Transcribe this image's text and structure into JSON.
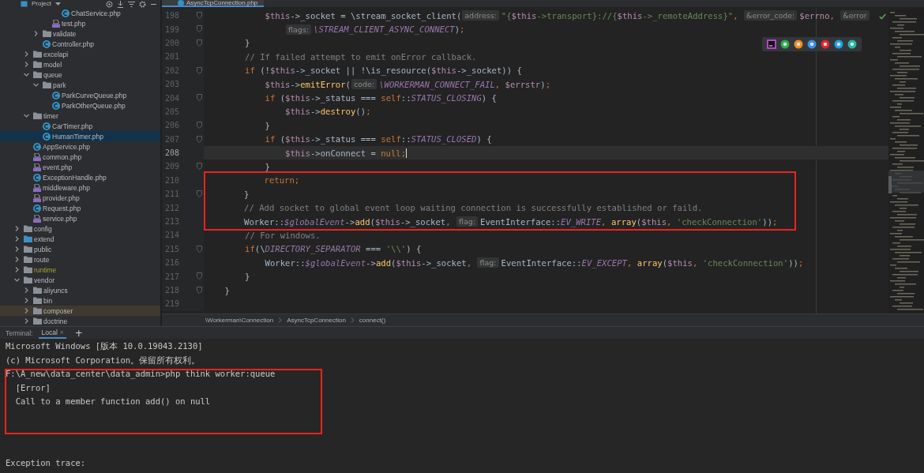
{
  "sidebar": {
    "title": "Project",
    "tree": [
      {
        "children": [
          {
            "children": [
              {
                "children": [
                  {
                    "children": [
                      {
                        "label": "ChatService.php",
                        "kind": "class-file",
                        "selected": false,
                        "hovered": false
                      }
                    ]
                  },
                  {
                    "label": "test.php",
                    "kind": "php-file",
                    "selected": false,
                    "hovered": false
                  }
                ]
              },
              {
                "label": "validate",
                "kind": "folder",
                "expanded": false,
                "selected": false,
                "hovered": false
              },
              {
                "label": "Controller.php",
                "kind": "class-file",
                "selected": false,
                "hovered": false
              }
            ]
          },
          {
            "label": "excelapi",
            "kind": "folder",
            "expanded": false,
            "selected": false,
            "hovered": false
          },
          {
            "label": "model",
            "kind": "folder",
            "expanded": false,
            "selected": false,
            "hovered": false
          },
          {
            "label": "queue",
            "kind": "folder",
            "expanded": true,
            "selected": false,
            "hovered": false,
            "children": [
              {
                "label": "park",
                "kind": "folder",
                "expanded": true,
                "selected": false,
                "hovered": false,
                "children": [
                  {
                    "label": "ParkCurveQueue.php",
                    "kind": "class-file",
                    "selected": false,
                    "hovered": false
                  },
                  {
                    "label": "ParkOtherQueue.php",
                    "kind": "class-file",
                    "selected": false,
                    "hovered": false
                  }
                ]
              }
            ]
          },
          {
            "label": "timer",
            "kind": "folder",
            "expanded": true,
            "selected": false,
            "hovered": false,
            "children": [
              {
                "label": "CarTimer.php",
                "kind": "class-file",
                "selected": false,
                "hovered": false
              },
              {
                "label": "HumanTimer.php",
                "kind": "class-file",
                "selected": true,
                "hovered": false
              }
            ]
          },
          {
            "label": "AppService.php",
            "kind": "class-file",
            "selected": false,
            "hovered": false
          },
          {
            "label": "common.php",
            "kind": "php-file",
            "selected": false,
            "hovered": false
          },
          {
            "label": "event.php",
            "kind": "php-file",
            "selected": false,
            "hovered": false
          },
          {
            "label": "ExceptionHandle.php",
            "kind": "class-file",
            "selected": false,
            "hovered": false
          },
          {
            "label": "middleware.php",
            "kind": "php-file",
            "selected": false,
            "hovered": false
          },
          {
            "label": "provider.php",
            "kind": "php-file",
            "selected": false,
            "hovered": false
          },
          {
            "label": "Request.php",
            "kind": "class-file",
            "selected": false,
            "hovered": false
          },
          {
            "label": "service.php",
            "kind": "php-file",
            "selected": false,
            "hovered": false
          }
        ]
      },
      {
        "label": "config",
        "kind": "folder",
        "expanded": false,
        "selected": false,
        "hovered": false
      },
      {
        "label": "extend",
        "kind": "source-folder",
        "expanded": false,
        "selected": false,
        "hovered": false
      },
      {
        "label": "public",
        "kind": "folder",
        "expanded": false,
        "selected": false,
        "hovered": false
      },
      {
        "label": "route",
        "kind": "folder",
        "expanded": false,
        "selected": false,
        "hovered": false
      },
      {
        "label": "runtime",
        "kind": "excluded-folder",
        "expanded": false,
        "selected": false,
        "hovered": false
      },
      {
        "label": "vendor",
        "kind": "folder",
        "expanded": true,
        "selected": false,
        "hovered": false,
        "children": [
          {
            "label": "aliyuncs",
            "kind": "folder",
            "expanded": false,
            "selected": false,
            "hovered": false
          },
          {
            "label": "bin",
            "kind": "folder",
            "expanded": false,
            "selected": false,
            "hovered": false
          },
          {
            "label": "composer",
            "kind": "folder",
            "expanded": false,
            "selected": false,
            "hovered": true
          },
          {
            "label": "doctrine",
            "kind": "folder",
            "expanded": false,
            "selected": false,
            "hovered": false
          }
        ]
      }
    ]
  },
  "editor": {
    "tabs": [
      {
        "label": "AsyncTcpConnection.php",
        "selected": true
      }
    ],
    "lines": [
      {
        "number": "198",
        "fold": true,
        "current": false,
        "boxed": false,
        "tokens": [
          {
            "kind": "var",
            "text": "            $this"
          },
          {
            "kind": "plain",
            "text": "->_socket = \\stream_socket_client("
          },
          {
            "kind": "hint",
            "text": "address:"
          },
          {
            "kind": "string",
            "text": "\"{"
          },
          {
            "kind": "var",
            "text": "$this"
          },
          {
            "kind": "string",
            "text": "->transport}://{"
          },
          {
            "kind": "var",
            "text": "$this"
          },
          {
            "kind": "string",
            "text": "->_remoteAddress}\""
          },
          {
            "kind": "keyword",
            "text": ", "
          },
          {
            "kind": "hint",
            "text": "&error_code:"
          },
          {
            "kind": "var",
            "text": "$errno"
          },
          {
            "kind": "keyword",
            "text": ", "
          },
          {
            "kind": "hint",
            "text": "&error"
          }
        ]
      },
      {
        "number": "199",
        "fold": true,
        "current": false,
        "boxed": false,
        "tokens": [
          {
            "kind": "hint",
            "text": "                flags:"
          },
          {
            "kind": "const",
            "text": "\\STREAM_CLIENT_ASYNC_CONNECT"
          },
          {
            "kind": "plain",
            "text": ")"
          },
          {
            "kind": "keyword",
            "text": ";"
          }
        ]
      },
      {
        "number": "200",
        "fold": true,
        "current": false,
        "boxed": false,
        "tokens": [
          {
            "kind": "plain",
            "text": "        }"
          }
        ]
      },
      {
        "number": "201",
        "fold": false,
        "current": false,
        "boxed": false,
        "tokens": [
          {
            "kind": "comment",
            "text": "        // If failed attempt to emit onError callback."
          }
        ]
      },
      {
        "number": "202",
        "fold": true,
        "current": false,
        "boxed": false,
        "tokens": [
          {
            "kind": "keyword",
            "text": "        if"
          },
          {
            "kind": "plain",
            "text": " (!"
          },
          {
            "kind": "var",
            "text": "$this"
          },
          {
            "kind": "plain",
            "text": "->_socket || !\\is_resource("
          },
          {
            "kind": "var",
            "text": "$this"
          },
          {
            "kind": "plain",
            "text": "->_socket)) {"
          }
        ]
      },
      {
        "number": "203",
        "fold": false,
        "current": false,
        "boxed": false,
        "tokens": [
          {
            "kind": "var",
            "text": "            $this"
          },
          {
            "kind": "plain",
            "text": "->"
          },
          {
            "kind": "function",
            "text": "emitError"
          },
          {
            "kind": "plain",
            "text": "("
          },
          {
            "kind": "hint",
            "text": "code:"
          },
          {
            "kind": "const",
            "text": "\\WORKERMAN_CONNECT_FAIL"
          },
          {
            "kind": "keyword",
            "text": ", "
          },
          {
            "kind": "var",
            "text": "$errstr"
          },
          {
            "kind": "plain",
            "text": ")"
          },
          {
            "kind": "keyword",
            "text": ";"
          }
        ]
      },
      {
        "number": "204",
        "fold": true,
        "current": false,
        "boxed": false,
        "tokens": [
          {
            "kind": "keyword",
            "text": "            if"
          },
          {
            "kind": "plain",
            "text": " ("
          },
          {
            "kind": "var",
            "text": "$this"
          },
          {
            "kind": "plain",
            "text": "->_status === "
          },
          {
            "kind": "keyword",
            "text": "self"
          },
          {
            "kind": "plain",
            "text": "::"
          },
          {
            "kind": "const",
            "text": "STATUS_CLOSING"
          },
          {
            "kind": "plain",
            "text": ") {"
          }
        ]
      },
      {
        "number": "205",
        "fold": false,
        "current": false,
        "boxed": false,
        "tokens": [
          {
            "kind": "var",
            "text": "                $this"
          },
          {
            "kind": "plain",
            "text": "->"
          },
          {
            "kind": "function",
            "text": "destroy"
          },
          {
            "kind": "plain",
            "text": "()"
          },
          {
            "kind": "keyword",
            "text": ";"
          }
        ]
      },
      {
        "number": "206",
        "fold": true,
        "current": false,
        "boxed": false,
        "tokens": [
          {
            "kind": "plain",
            "text": "            }"
          }
        ]
      },
      {
        "number": "207",
        "fold": true,
        "current": false,
        "boxed": false,
        "tokens": [
          {
            "kind": "keyword",
            "text": "            if"
          },
          {
            "kind": "plain",
            "text": " ("
          },
          {
            "kind": "var",
            "text": "$this"
          },
          {
            "kind": "plain",
            "text": "->_status === "
          },
          {
            "kind": "keyword",
            "text": "self"
          },
          {
            "kind": "plain",
            "text": "::"
          },
          {
            "kind": "const",
            "text": "STATUS_CLOSED"
          },
          {
            "kind": "plain",
            "text": ") {"
          }
        ]
      },
      {
        "number": "208",
        "fold": false,
        "current": true,
        "boxed": false,
        "tokens": [
          {
            "kind": "var",
            "text": "                $this"
          },
          {
            "kind": "plain",
            "text": "->onConnect = "
          },
          {
            "kind": "keyword",
            "text": "null;"
          }
        ]
      },
      {
        "number": "209",
        "fold": true,
        "current": false,
        "boxed": false,
        "tokens": [
          {
            "kind": "plain",
            "text": "            }"
          }
        ]
      },
      {
        "number": "210",
        "fold": false,
        "current": false,
        "boxed": true,
        "tokens": [
          {
            "kind": "keyword",
            "text": "            return;"
          }
        ]
      },
      {
        "number": "211",
        "fold": true,
        "current": false,
        "boxed": true,
        "tokens": [
          {
            "kind": "plain",
            "text": "        }"
          }
        ]
      },
      {
        "number": "212",
        "fold": false,
        "current": false,
        "boxed": true,
        "tokens": [
          {
            "kind": "comment",
            "text": "        // Add socket to global event loop waiting connection is successfully established or faild."
          }
        ]
      },
      {
        "number": "213",
        "fold": false,
        "current": false,
        "boxed": true,
        "tokens": [
          {
            "kind": "plain",
            "text": "        Worker::"
          },
          {
            "kind": "const",
            "text": "$globalEvent"
          },
          {
            "kind": "plain",
            "text": "->"
          },
          {
            "kind": "function",
            "text": "add"
          },
          {
            "kind": "plain",
            "text": "("
          },
          {
            "kind": "var",
            "text": "$this"
          },
          {
            "kind": "plain",
            "text": "->_socket"
          },
          {
            "kind": "keyword",
            "text": ", "
          },
          {
            "kind": "hint",
            "text": "flag:"
          },
          {
            "kind": "plain",
            "text": "EventInterface::"
          },
          {
            "kind": "const",
            "text": "EV_WRITE"
          },
          {
            "kind": "keyword",
            "text": ", "
          },
          {
            "kind": "function",
            "text": "array"
          },
          {
            "kind": "plain",
            "text": "("
          },
          {
            "kind": "var",
            "text": "$this"
          },
          {
            "kind": "keyword",
            "text": ", "
          },
          {
            "kind": "string",
            "text": "'checkConnection'"
          },
          {
            "kind": "plain",
            "text": "))"
          },
          {
            "kind": "keyword",
            "text": ";"
          }
        ]
      },
      {
        "number": "214",
        "fold": false,
        "current": false,
        "boxed": false,
        "tokens": [
          {
            "kind": "comment",
            "text": "        // For windows."
          }
        ]
      },
      {
        "number": "215",
        "fold": true,
        "current": false,
        "boxed": false,
        "tokens": [
          {
            "kind": "keyword",
            "text": "        if"
          },
          {
            "kind": "plain",
            "text": "(\\"
          },
          {
            "kind": "const",
            "text": "DIRECTORY_SEPARATOR"
          },
          {
            "kind": "plain",
            "text": " === "
          },
          {
            "kind": "string",
            "text": "'\\\\'"
          },
          {
            "kind": "plain",
            "text": ") {"
          }
        ]
      },
      {
        "number": "216",
        "fold": false,
        "current": false,
        "boxed": false,
        "tokens": [
          {
            "kind": "plain",
            "text": "            Worker::"
          },
          {
            "kind": "const",
            "text": "$globalEvent"
          },
          {
            "kind": "plain",
            "text": "->"
          },
          {
            "kind": "function",
            "text": "add"
          },
          {
            "kind": "plain",
            "text": "("
          },
          {
            "kind": "var",
            "text": "$this"
          },
          {
            "kind": "plain",
            "text": "->_socket"
          },
          {
            "kind": "keyword",
            "text": ", "
          },
          {
            "kind": "hint",
            "text": "flag:"
          },
          {
            "kind": "plain",
            "text": "EventInterface::"
          },
          {
            "kind": "const",
            "text": "EV_EXCEPT"
          },
          {
            "kind": "keyword",
            "text": ", "
          },
          {
            "kind": "function",
            "text": "array"
          },
          {
            "kind": "plain",
            "text": "("
          },
          {
            "kind": "var",
            "text": "$this"
          },
          {
            "kind": "keyword",
            "text": ", "
          },
          {
            "kind": "string",
            "text": "'checkConnection'"
          },
          {
            "kind": "plain",
            "text": "))"
          },
          {
            "kind": "keyword",
            "text": ";"
          }
        ]
      },
      {
        "number": "217",
        "fold": true,
        "current": false,
        "boxed": false,
        "tokens": [
          {
            "kind": "plain",
            "text": "        }"
          }
        ]
      },
      {
        "number": "218",
        "fold": true,
        "current": false,
        "boxed": false,
        "tokens": [
          {
            "kind": "plain",
            "text": "    }"
          }
        ]
      },
      {
        "number": "219",
        "fold": false,
        "current": false,
        "boxed": false
      }
    ],
    "breadcrumbs": [
      "\\Workerman\\Connection",
      "AsyncTcpConnection",
      "connect()"
    ]
  },
  "terminal": {
    "title": "Terminal:",
    "tabs": [
      {
        "label": "Local",
        "selected": true,
        "close": "×"
      }
    ],
    "add": "+",
    "lines": [
      {
        "text": "Microsoft Windows [版本 10.0.19043.2130]",
        "boxed": false
      },
      {
        "text": "(c) Microsoft Corporation。保留所有权利。",
        "boxed": false
      },
      {
        "text": "F:\\A_new\\data_center\\data_admin>php think worker:queue",
        "boxed": true
      },
      {
        "text": "  [Error]",
        "boxed": true
      },
      {
        "text": "  Call to a member function add() on null",
        "boxed": true
      },
      {
        "text": "Exception trace:",
        "boxed": false
      }
    ]
  }
}
